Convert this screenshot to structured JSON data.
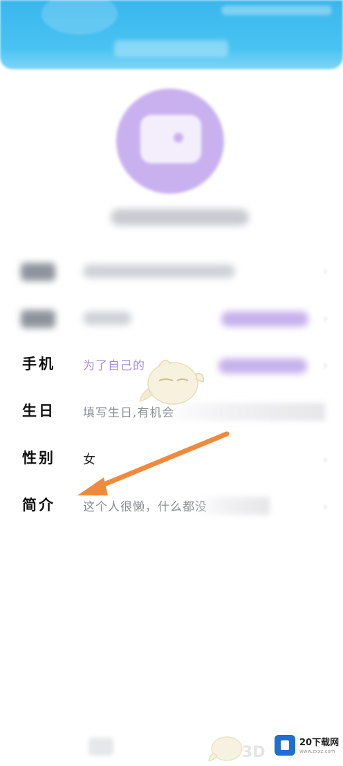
{
  "profile": {
    "rows": {
      "phone": {
        "label": "手机",
        "value": "为了自己的"
      },
      "birthday": {
        "label": "生日",
        "value": "填写生日,有机会"
      },
      "gender": {
        "label": "性别",
        "value": "女"
      },
      "intro": {
        "label": "简介",
        "value": "这个人很懒，什么都没"
      }
    }
  },
  "watermark": {
    "text": "3D",
    "brand": "20下载网",
    "url": "www.zxxz.com"
  },
  "colors": {
    "header": "#3ab6ec",
    "avatar": "#c9b1ef",
    "arrow": "#ef8a3b",
    "watermark_logo": "#1f6fd1"
  }
}
